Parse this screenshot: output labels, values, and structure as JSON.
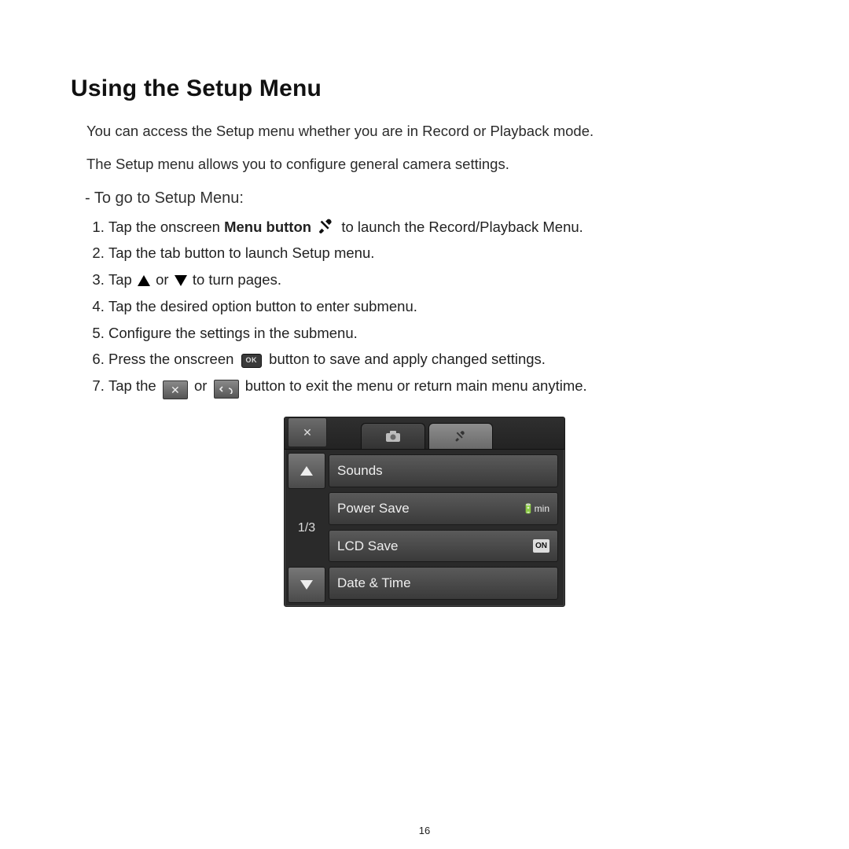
{
  "title": "Using the Setup Menu",
  "intro1": "You can access the Setup menu whether you are in Record or Playback mode.",
  "intro2": "The Setup menu allows you to configure general camera settings.",
  "subhead": "- To go to Setup Menu:",
  "icons": {
    "ok": "OK"
  },
  "steps": [
    {
      "a": "Tap the onscreen ",
      "bold": "Menu button",
      "b": " to launch the Record/Playback Menu."
    },
    {
      "text": "Tap the tab button to launch Setup menu."
    },
    {
      "a": "Tap ",
      "mid": " or ",
      "b": " to turn pages."
    },
    {
      "text": "Tap the desired option button to enter submenu."
    },
    {
      "text": "Configure the settings in the submenu."
    },
    {
      "a": "Press the onscreen ",
      "b": " button to save and apply changed settings."
    },
    {
      "a": "Tap the ",
      "mid": " or ",
      "b": " button to exit the menu or return main menu anytime."
    }
  ],
  "device": {
    "page": "1/3",
    "rows": [
      {
        "label": "Sounds"
      },
      {
        "label": "Power Save",
        "value": "🔋min"
      },
      {
        "label": "LCD Save",
        "value": "ON"
      },
      {
        "label": "Date & Time"
      }
    ]
  },
  "page_number": "16"
}
